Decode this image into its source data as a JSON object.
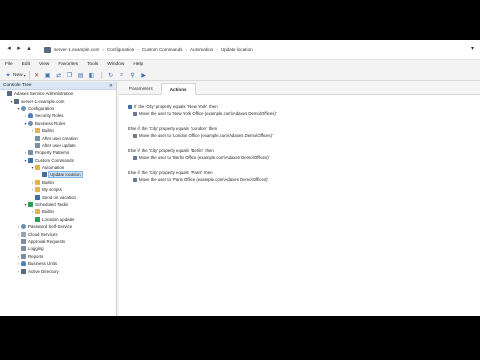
{
  "address": {
    "crumbs": [
      "server-1.example.com",
      "Configuration",
      "Custom Commands",
      "Automation",
      "Update location"
    ]
  },
  "menu": [
    "File",
    "Edit",
    "View",
    "Favorites",
    "Tools",
    "Window",
    "Help"
  ],
  "toolbar": {
    "new_label": "New"
  },
  "console": {
    "title": "Console Tree",
    "items": [
      {
        "label": "Adaxes Service Administration",
        "depth": 0,
        "tw": "",
        "icon": "server"
      },
      {
        "label": "server-1.example.com",
        "depth": 1,
        "tw": "▾",
        "icon": "server"
      },
      {
        "label": "Configuration",
        "depth": 2,
        "tw": "▾",
        "icon": "gear"
      },
      {
        "label": "Security Roles",
        "depth": 3,
        "tw": "›",
        "icon": "users"
      },
      {
        "label": "Business Rules",
        "depth": 3,
        "tw": "▾",
        "icon": "gear"
      },
      {
        "label": "Builtin",
        "depth": 4,
        "tw": "›",
        "icon": "folder"
      },
      {
        "label": "After user creation",
        "depth": 4,
        "tw": "",
        "icon": "doc"
      },
      {
        "label": "After user update",
        "depth": 4,
        "tw": "",
        "icon": "doc"
      },
      {
        "label": "Property Patterns",
        "depth": 3,
        "tw": "›",
        "icon": "doc"
      },
      {
        "label": "Custom Commands",
        "depth": 3,
        "tw": "▾",
        "icon": "cmd"
      },
      {
        "label": "Automation",
        "depth": 4,
        "tw": "▾",
        "icon": "folder"
      },
      {
        "label": "Update location",
        "depth": 5,
        "tw": "",
        "icon": "cmd",
        "selected": true
      },
      {
        "label": "Builtin",
        "depth": 4,
        "tw": "›",
        "icon": "folder"
      },
      {
        "label": "My scripts",
        "depth": 4,
        "tw": "›",
        "icon": "folder"
      },
      {
        "label": "Send on vacation",
        "depth": 4,
        "tw": "",
        "icon": "cmd"
      },
      {
        "label": "Scheduled Tasks",
        "depth": 3,
        "tw": "▾",
        "icon": "green"
      },
      {
        "label": "Builtin",
        "depth": 4,
        "tw": "›",
        "icon": "folder"
      },
      {
        "label": "Location updater",
        "depth": 4,
        "tw": "",
        "icon": "green"
      },
      {
        "label": "Password Self-Service",
        "depth": 2,
        "tw": "›",
        "icon": "gear"
      },
      {
        "label": "Cloud Services",
        "depth": 2,
        "tw": "›",
        "icon": "grey"
      },
      {
        "label": "Approval Requests",
        "depth": 2,
        "tw": "",
        "icon": "doc"
      },
      {
        "label": "Logging",
        "depth": 2,
        "tw": "",
        "icon": "doc"
      },
      {
        "label": "Reports",
        "depth": 2,
        "tw": "›",
        "icon": "doc"
      },
      {
        "label": "Business Units",
        "depth": 2,
        "tw": "›",
        "icon": "users"
      },
      {
        "label": "Active Directory",
        "depth": 2,
        "tw": "›",
        "icon": "server"
      }
    ]
  },
  "tabs": [
    {
      "label": "Parameters",
      "active": false
    },
    {
      "label": "Actions",
      "active": true
    }
  ],
  "rules": [
    {
      "keyword": "If",
      "condition_prefix": "the 'City' property equals",
      "condition_value": "'New York'",
      "then": "then",
      "action": "Move the user to 'New York Office (example.com\\Adaxes Demo\\Offices)'"
    },
    {
      "keyword": "Else if",
      "condition_prefix": "the 'City' property equals",
      "condition_value": "'London'",
      "then": "then",
      "action": "Move the user to 'London Office (example.com\\Adaxes Demo\\Offices)'"
    },
    {
      "keyword": "Else if",
      "condition_prefix": "the 'City' property equals",
      "condition_value": "'Berlin'",
      "then": "then",
      "action": "Move the user to 'Berlin Office (example.com\\Adaxes Demo\\Offices)'"
    },
    {
      "keyword": "Else if",
      "condition_prefix": "the 'City' property equals",
      "condition_value": "'Paris'",
      "then": "then",
      "action": "Move the user to 'Paris Office (example.com\\Adaxes Demo\\Offices)'"
    }
  ]
}
